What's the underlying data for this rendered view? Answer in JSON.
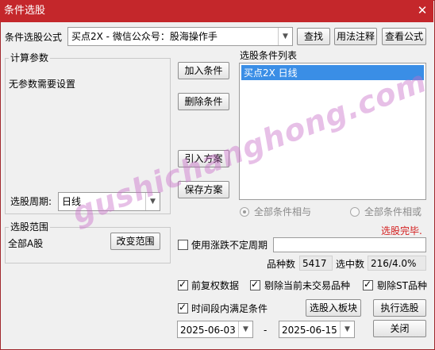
{
  "window": {
    "title": "条件选股",
    "close_glyph": "✕"
  },
  "formula": {
    "label": "条件选股公式",
    "value": "买点2X  -  微信公众号：股海操作手",
    "find_button": "查找",
    "usage_button": "用法注释",
    "view_button": "查看公式"
  },
  "params": {
    "group_title": "计算参数",
    "message": "无参数需要设置",
    "period_label": "选股周期:",
    "period_value": "日线"
  },
  "actions": {
    "add": "加入条件",
    "delete": "删除条件",
    "import": "引入方案",
    "save": "保存方案"
  },
  "conditions": {
    "title": "选股条件列表",
    "items": [
      "买点2X  日线"
    ],
    "selected_index": 0,
    "radio_and": "全部条件相与",
    "radio_or": "全部条件相或"
  },
  "status": {
    "text": "选股完毕.",
    "color": "#d42020"
  },
  "range": {
    "group_title": "选股范围",
    "value": "全部A股",
    "change_button": "改变范围"
  },
  "options": {
    "use_irregular_period": "使用涨跌不定周期",
    "count_label": "品种数",
    "count_value": "5417",
    "selected_label": "选中数",
    "selected_value": "216/4.0%",
    "forward_adjust": "前复权数据",
    "exclude_untraded": "剔除当前未交易品种",
    "exclude_st": "剔除ST品种",
    "period_condition": "时间段内满足条件"
  },
  "dates": {
    "start": "2025-06-03",
    "separator": "-",
    "end": "2025-06-15"
  },
  "buttons": {
    "to_block": "选股入板块",
    "execute": "执行选股",
    "close": "关闭"
  },
  "watermark": "gushichanghong.com",
  "colors": {
    "titlebar": "#c4272b",
    "selection": "#3a8ee6"
  }
}
